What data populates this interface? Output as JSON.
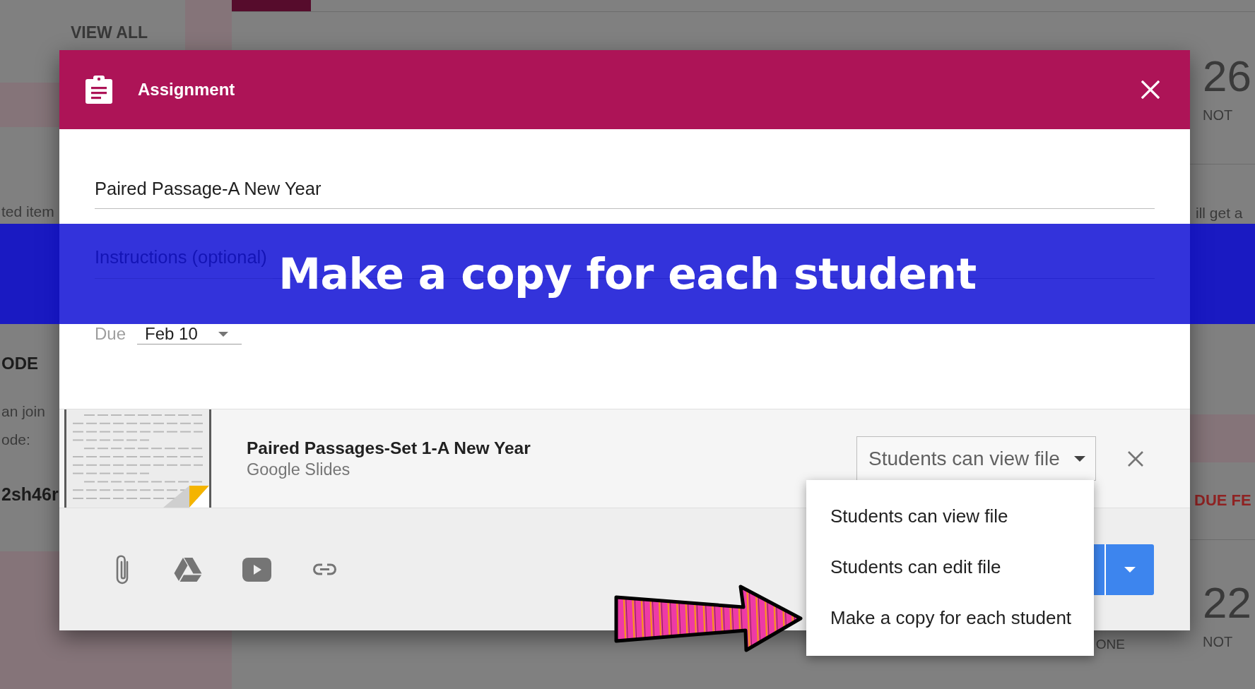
{
  "background": {
    "left_cards": [
      {
        "items": [
          {
            "kind": "link",
            "text": "VIEW ALL"
          }
        ]
      },
      {
        "items": [
          {
            "kind": "text",
            "text": "ted item"
          },
          {
            "kind": "heading",
            "text": "ODE"
          },
          {
            "kind": "text",
            "text": "an join"
          },
          {
            "kind": "text",
            "text": "ode:"
          },
          {
            "kind": "code",
            "text": "2sh46r"
          }
        ]
      }
    ],
    "main_column": {
      "stat_label": "ONE"
    },
    "right_cards": [
      {
        "items": [
          {
            "kind": "count",
            "text": "26"
          },
          {
            "kind": "label",
            "text": "NOT"
          }
        ]
      },
      {
        "items": [
          {
            "kind": "text",
            "text": "ill get a"
          }
        ]
      },
      {
        "items": [
          {
            "kind": "due",
            "text": "DUE FE"
          }
        ]
      },
      {
        "items": [
          {
            "kind": "count",
            "text": "22"
          },
          {
            "kind": "label",
            "text": "NOT"
          }
        ]
      }
    ]
  },
  "dialog": {
    "title": "Assignment",
    "title_field": {
      "value": "Paired Passage-A New Year"
    },
    "instructions_field": {
      "placeholder": "Instructions (optional)"
    },
    "due": {
      "label": "Due",
      "value": "Feb 10"
    },
    "attachment": {
      "title": "Paired Passages-Set 1-A New Year",
      "subtitle": "Google Slides",
      "permission": "Students can view file"
    },
    "permission_menu": {
      "items": [
        "Students can view file",
        "Students can edit file",
        "Make a copy for each student"
      ]
    }
  },
  "caption": {
    "text": "Make a copy for each student"
  }
}
